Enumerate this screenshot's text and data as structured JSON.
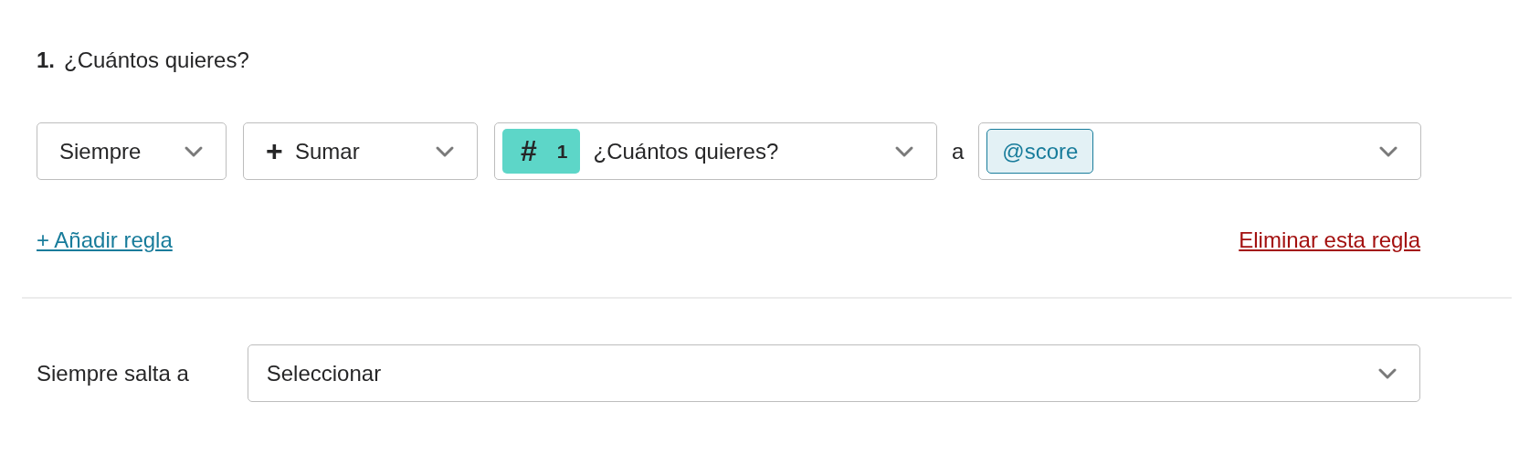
{
  "question": {
    "number": "1.",
    "title": "¿Cuántos quieres?"
  },
  "rule": {
    "condition": {
      "value": "Siempre"
    },
    "operation": {
      "value": "Sumar",
      "icon": "+"
    },
    "source": {
      "badge_icon": "#",
      "badge_number": "1",
      "value": "¿Cuántos quieres?"
    },
    "connector": "a",
    "target": {
      "tag": "@score"
    }
  },
  "links": {
    "add": "+ Añadir regla",
    "remove": "Eliminar esta regla"
  },
  "jump": {
    "label": "Siempre salta a",
    "placeholder": "Seleccionar"
  }
}
